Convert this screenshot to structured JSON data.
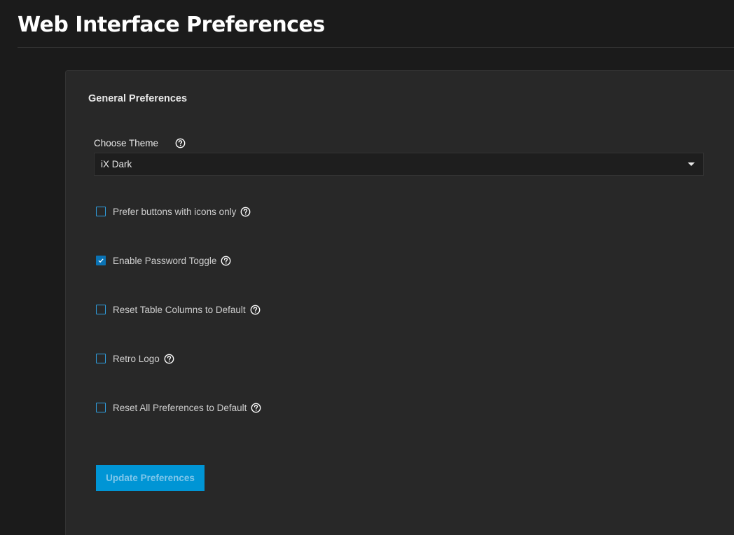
{
  "page": {
    "title": "Web Interface Preferences"
  },
  "card": {
    "title": "General Preferences",
    "theme": {
      "label": "Choose Theme",
      "help_icon": "help-circle-icon",
      "selected": "iX Dark",
      "caret_icon": "caret-down-icon"
    },
    "checkboxes": [
      {
        "label": "Prefer buttons with icons only",
        "checked": false
      },
      {
        "label": "Enable Password Toggle",
        "checked": true
      },
      {
        "label": "Reset Table Columns to Default",
        "checked": false
      },
      {
        "label": "Retro Logo",
        "checked": false
      },
      {
        "label": "Reset All Preferences to Default",
        "checked": false
      }
    ],
    "submit_label": "Update Preferences"
  },
  "colors": {
    "background": "#1b1b1b",
    "card": "#282828",
    "accent": "#0095d5",
    "checkbox_border": "#2f9fe0",
    "checkbox_checked": "#0a73b5"
  }
}
